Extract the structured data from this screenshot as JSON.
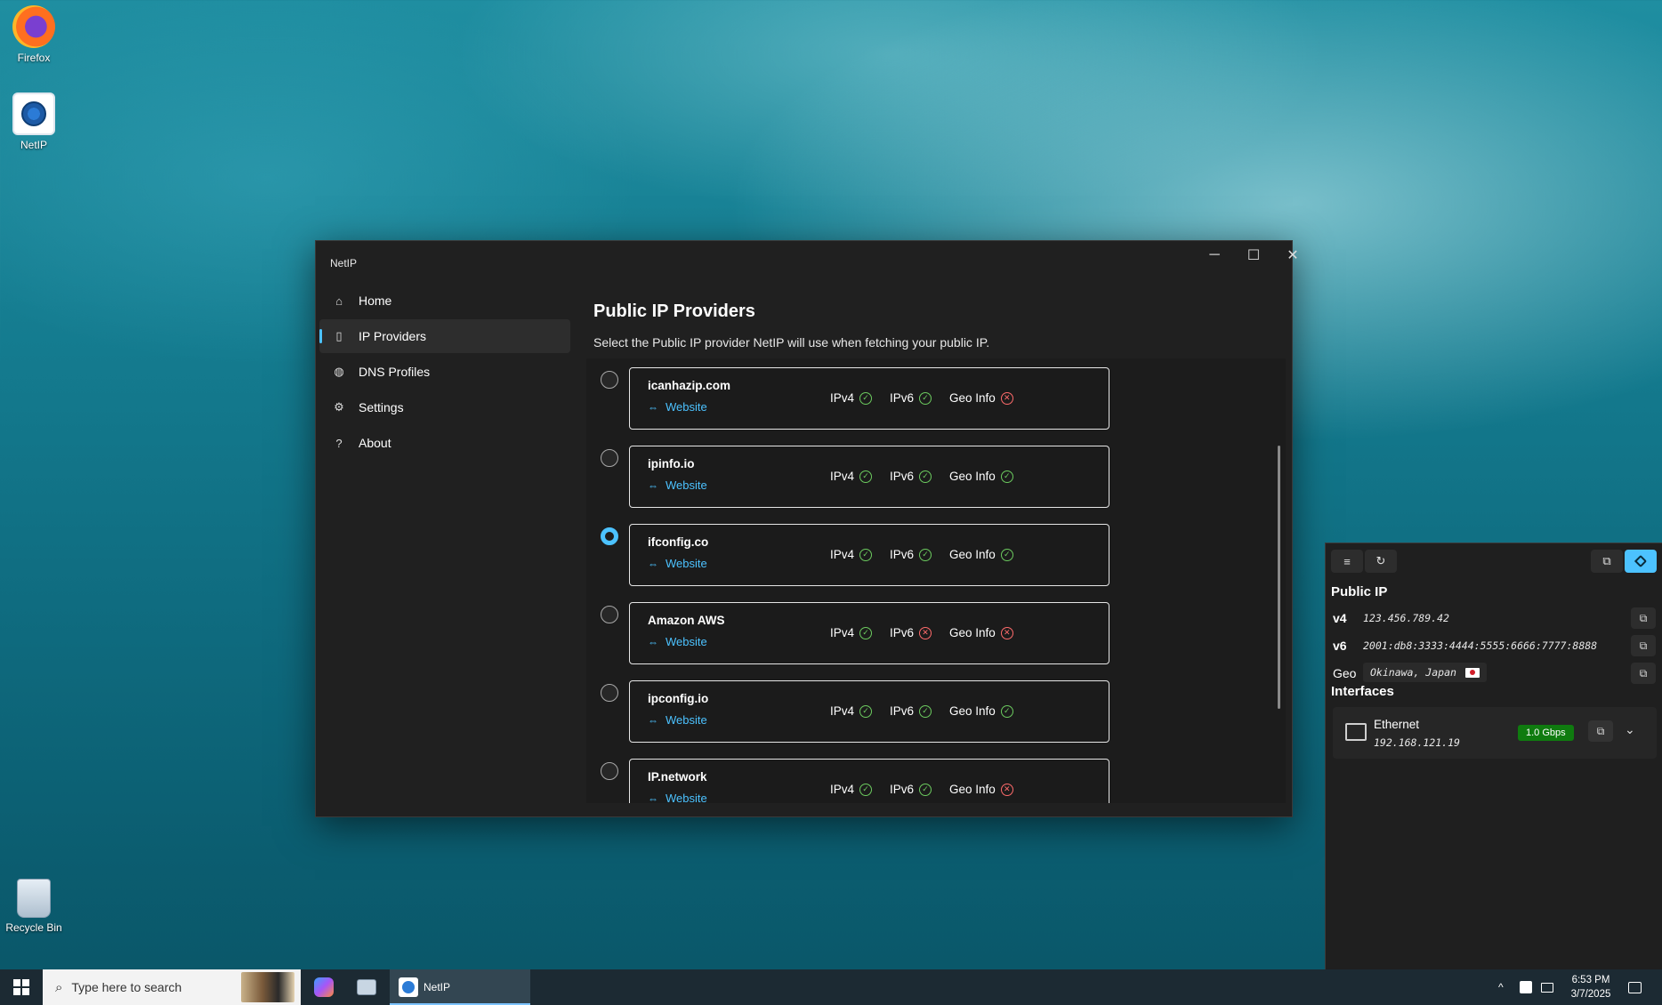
{
  "desktop": {
    "icons": [
      {
        "label": "Firefox",
        "icon": "firefox-icon"
      },
      {
        "label": "NetIP",
        "icon": "netip-app-icon"
      },
      {
        "label": "Recycle Bin",
        "icon": "recycle-bin-icon"
      }
    ]
  },
  "window": {
    "title": "NetIP",
    "controls": {
      "minimize": "─",
      "maximize": "☐",
      "close": "✕"
    }
  },
  "sidebar": {
    "items": [
      {
        "label": "Home",
        "icon": "home-icon",
        "glyph": "⌂",
        "selected": false
      },
      {
        "label": "IP Providers",
        "icon": "phone-icon",
        "glyph": "▯",
        "selected": true
      },
      {
        "label": "DNS Profiles",
        "icon": "globe-icon",
        "glyph": "◍",
        "selected": false
      },
      {
        "label": "Settings",
        "icon": "gear-icon",
        "glyph": "⚙",
        "selected": false
      },
      {
        "label": "About",
        "icon": "question-icon",
        "glyph": "?",
        "selected": false
      }
    ]
  },
  "main": {
    "title": "Public IP Providers",
    "description": "Select the Public IP provider NetIP will use when fetching your public IP.",
    "capability_labels": {
      "ipv4": "IPv4",
      "ipv6": "IPv6",
      "geo": "Geo Info"
    },
    "website_label": "Website",
    "providers": [
      {
        "name": "icanhazip.com",
        "selected": false,
        "ipv4": true,
        "ipv6": true,
        "geo": false
      },
      {
        "name": "ipinfo.io",
        "selected": false,
        "ipv4": true,
        "ipv6": true,
        "geo": true
      },
      {
        "name": "ifconfig.co",
        "selected": true,
        "ipv4": true,
        "ipv6": true,
        "geo": true
      },
      {
        "name": "Amazon AWS",
        "selected": false,
        "ipv4": true,
        "ipv6": false,
        "geo": false
      },
      {
        "name": "ipconfig.io",
        "selected": false,
        "ipv4": true,
        "ipv6": true,
        "geo": true
      },
      {
        "name": "IP.network",
        "selected": false,
        "ipv4": true,
        "ipv6": true,
        "geo": false
      }
    ]
  },
  "flyout": {
    "toolbar": {
      "menu_icon": "≡",
      "refresh_icon": "↻",
      "compact_icon": "⧉",
      "pin_icon": "📌"
    },
    "public_ip_heading": "Public IP",
    "rows": [
      {
        "label": "v4",
        "value": "123.456.789.42"
      },
      {
        "label": "v6",
        "value": "2001:db8:3333:4444:5555:6666:7777:8888"
      }
    ],
    "geo": {
      "label": "Geo",
      "value": "Okinawa, Japan"
    },
    "interfaces_heading": "Interfaces",
    "interface": {
      "name": "Ethernet",
      "address": "192.168.121.19",
      "speed": "1.0 Gbps"
    },
    "copy_glyph": "⧉"
  },
  "taskbar": {
    "search_placeholder": "Type here to search",
    "active_app": "NetIP",
    "time": "6:53 PM",
    "date": "3/7/2025",
    "colors": {
      "accent": "#4cc2ff",
      "ok": "#6ccb5f",
      "fail": "#ff6b6b",
      "speed_badge": "#0f7b0f"
    }
  }
}
